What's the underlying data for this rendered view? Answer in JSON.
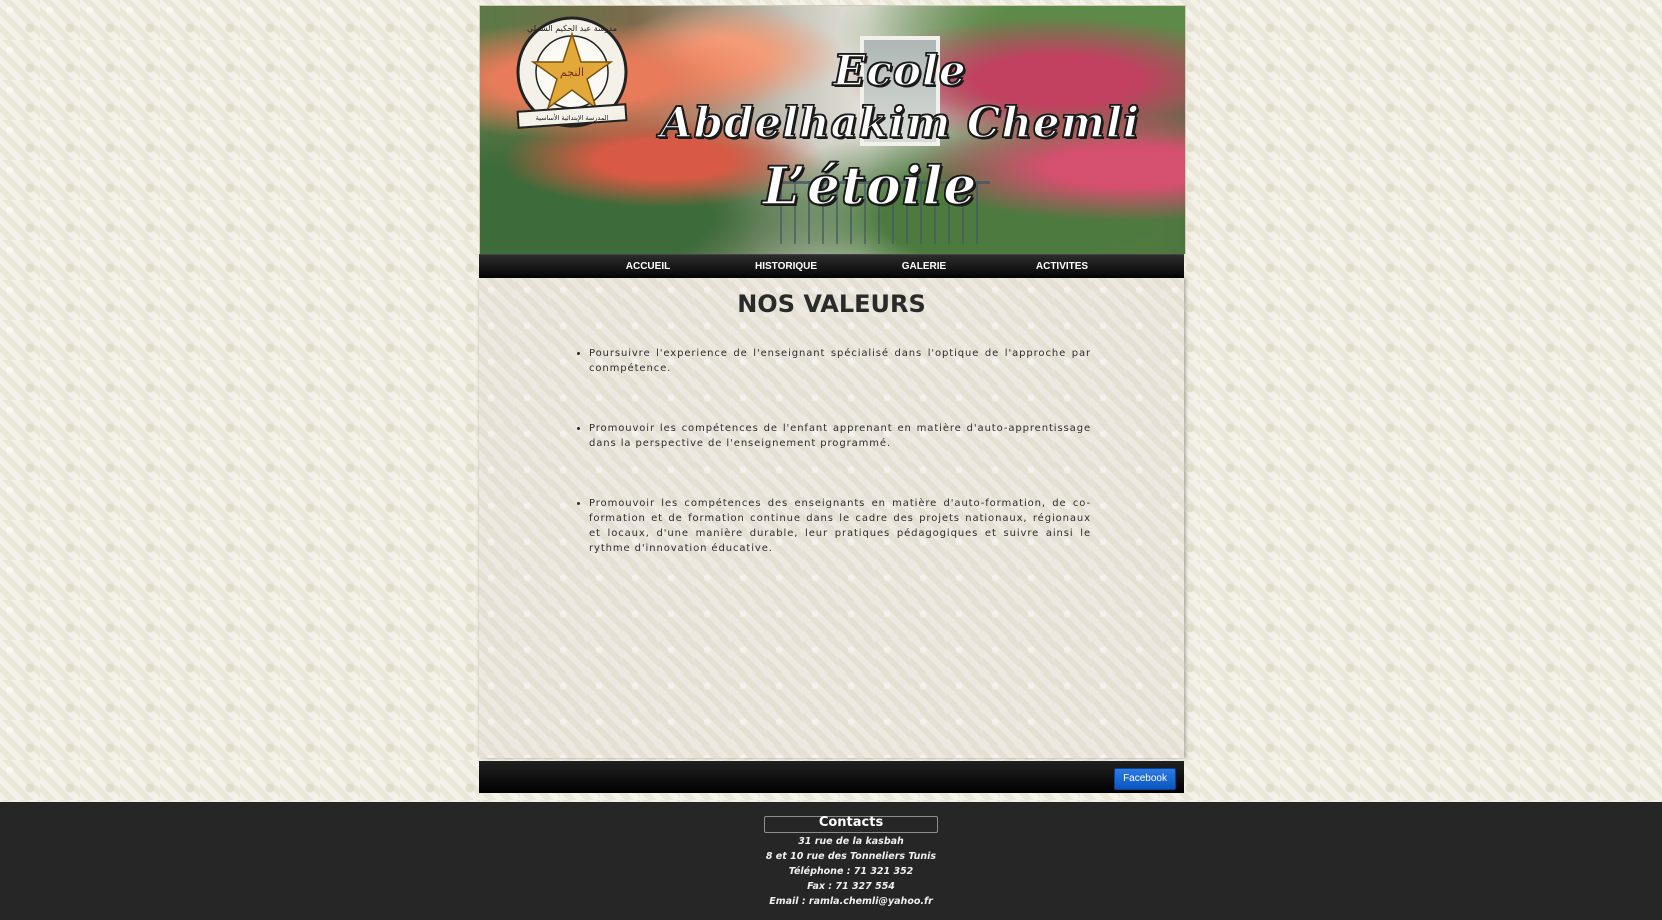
{
  "banner": {
    "line1": "Ecole",
    "line2": "Abdelhakim Chemli",
    "line3": "L’étoile",
    "logo_arabic_top": "مدرسة عبد الحكيم الشملي",
    "logo_center": "النجم",
    "logo_arabic_bottom": "المدرسة الإبتدائية الأساسية"
  },
  "nav": {
    "items": [
      {
        "label": "ACCUEIL"
      },
      {
        "label": "HISTORIQUE"
      },
      {
        "label": "GALERIE"
      },
      {
        "label": "ACTIVITES"
      }
    ]
  },
  "main": {
    "title": "NOS VALEURS",
    "values": [
      "Poursuivre l'experience de l'enseignant spécialisé dans l'optique de l'approche par conmpétence.",
      "Promouvoir les compétences de l'enfant apprenant en matière d'auto-apprentissage dans la perspective de l'enseignement programmé.",
      "Promouvoir les compétences des enseignants en matière d'auto-formation, de co-formation et de formation continue dans le cadre des projets nationaux, régionaux et locaux, d'une manière durable, leur pratiques pédagogiques et suivre ainsi le rythme d'innovation éducative."
    ]
  },
  "footer": {
    "facebook_label": "Facebook"
  },
  "contacts": {
    "title": "Contacts",
    "address1": "31 rue de la kasbah",
    "address2": "8 et 10 rue des Tonneliers Tunis",
    "phone": "Téléphone : 71 321 352",
    "fax": "Fax : 71 327 554",
    "email": "Email : ramla.chemli@yahoo.fr"
  },
  "colors": {
    "nav_bg": "#0d0d0d",
    "contacts_bg": "#262626",
    "facebook_blue": "#1a66d0"
  }
}
